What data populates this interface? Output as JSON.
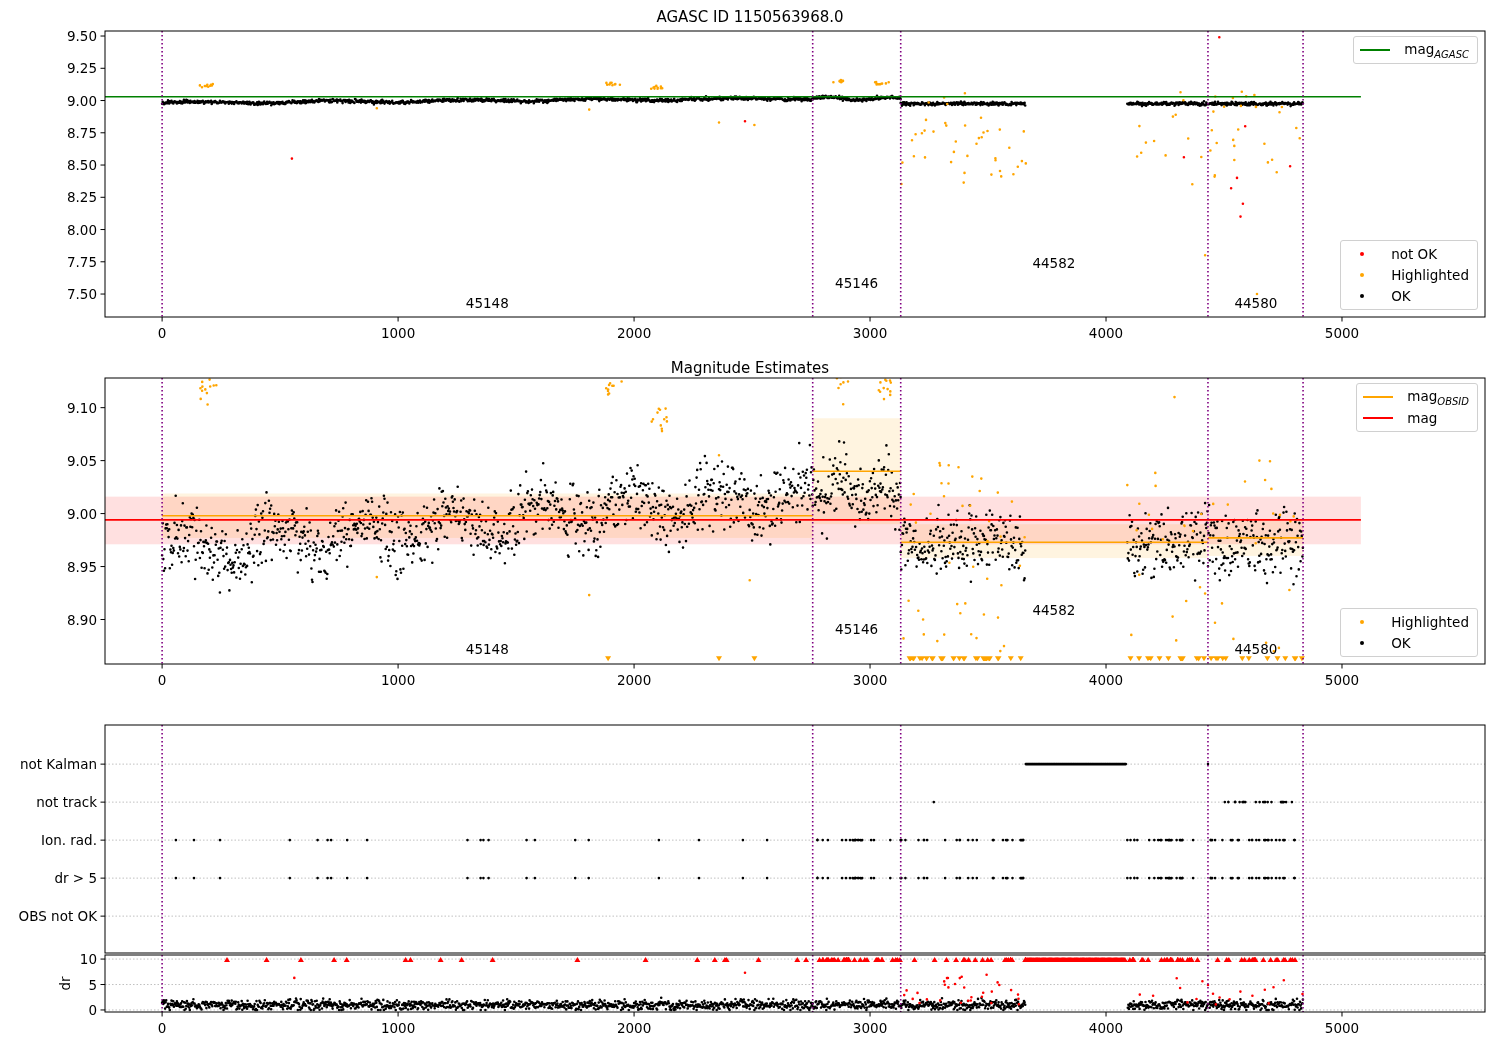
{
  "panels": [
    {
      "kind": "mag",
      "title": "AGASC ID 1150563968.0",
      "legends": [
        {
          "items": [
            {
              "label": "mag$_{AGASC}$",
              "color": "#008000",
              "kind": "line"
            }
          ]
        },
        {
          "items": [
            {
              "label": "not OK",
              "color": "#ff0000",
              "kind": "dot"
            },
            {
              "label": "Highlighted",
              "color": "#ffa500",
              "kind": "dot"
            },
            {
              "label": "OK",
              "color": "#000000",
              "kind": "dot"
            }
          ]
        }
      ],
      "chart_data": {
        "type": "scatter",
        "xlim": [
          -242,
          5606
        ],
        "ylim": [
          7.322,
          9.539
        ],
        "xticks": [
          0,
          1000,
          2000,
          3000,
          4000,
          5000
        ],
        "yticks": [
          {
            "value": 7.5,
            "label": "7.50"
          },
          {
            "value": 7.75,
            "label": "7.75"
          },
          {
            "value": 8.0,
            "label": "8.00"
          },
          {
            "value": 8.25,
            "label": "8.25"
          },
          {
            "value": 8.5,
            "label": "8.50"
          },
          {
            "value": 8.75,
            "label": "8.75"
          },
          {
            "value": 9.0,
            "label": "9.00"
          },
          {
            "value": 9.25,
            "label": "9.25"
          },
          {
            "value": 9.5,
            "label": "9.50"
          }
        ],
        "series": [
          {
            "type": "line",
            "color": "#008000",
            "x": [
              -242,
              5080
            ],
            "values": [
              9.03,
              9.03
            ]
          }
        ],
        "ref_lines": [
          {
            "axis": "x",
            "value": 0
          },
          {
            "axis": "x",
            "value": 2757
          },
          {
            "axis": "x",
            "value": 3130
          },
          {
            "axis": "x",
            "value": 4432
          },
          {
            "axis": "x",
            "value": 4835
          }
        ],
        "annotations": [
          "45148",
          "45146",
          "44582",
          "44580"
        ]
      }
    },
    {
      "kind": "magest",
      "title": "Magnitude Estimates",
      "legends": [
        {
          "items": [
            {
              "label": "mag$_{OBSID}$",
              "color": "#ffa500",
              "kind": "line"
            },
            {
              "label": "mag",
              "color": "#ff0000",
              "kind": "line"
            }
          ]
        },
        {
          "items": [
            {
              "label": "Highlighted",
              "color": "#ffa500",
              "kind": "dot"
            },
            {
              "label": "OK",
              "color": "#000000",
              "kind": "dot"
            }
          ]
        }
      ],
      "chart_data": {
        "type": "scatter",
        "xlim": [
          -242,
          5606
        ],
        "ylim": [
          8.858,
          9.128
        ],
        "xticks": [
          0,
          1000,
          2000,
          3000,
          4000,
          5000
        ],
        "yticks": [
          {
            "value": 8.9,
            "label": "8.90"
          },
          {
            "value": 8.95,
            "label": "8.95"
          },
          {
            "value": 9.0,
            "label": "9.00"
          },
          {
            "value": 9.05,
            "label": "9.05"
          },
          {
            "value": 9.1,
            "label": "9.10"
          }
        ],
        "series": [
          {
            "type": "line",
            "color": "#ffa500",
            "x": [
              0,
              2757
            ],
            "values": [
              8.998,
              8.998
            ]
          },
          {
            "type": "line",
            "color": "#ffa500",
            "x": [
              2757,
              3130
            ],
            "values": [
              9.04,
              9.04
            ]
          },
          {
            "type": "line",
            "color": "#ffa500",
            "x": [
              3130,
              4432
            ],
            "values": [
              8.973,
              8.973
            ]
          },
          {
            "type": "line",
            "color": "#ffa500",
            "x": [
              4432,
              4835
            ],
            "values": [
              8.977,
              8.977
            ]
          },
          {
            "type": "line",
            "color": "#ff0000",
            "x": [
              -242,
              5080
            ],
            "values": [
              8.994,
              8.994
            ]
          }
        ],
        "bands": [
          {
            "axis": "y",
            "from": 8.977,
            "to": 9.019,
            "color": "#ffa500"
          },
          {
            "axis": "y",
            "from": 8.99,
            "to": 9.09,
            "color": "#ffa500"
          },
          {
            "axis": "y",
            "from": 8.958,
            "to": 8.99,
            "color": "#ffa500"
          },
          {
            "axis": "y",
            "from": 8.96,
            "to": 8.994,
            "color": "#ffa500"
          },
          {
            "axis": "y",
            "from": 8.971,
            "to": 9.016,
            "color": "#ff0000"
          }
        ],
        "ref_lines": [
          {
            "axis": "x",
            "value": 0
          },
          {
            "axis": "x",
            "value": 2757
          },
          {
            "axis": "x",
            "value": 3130
          },
          {
            "axis": "x",
            "value": 4432
          },
          {
            "axis": "x",
            "value": 4835
          }
        ],
        "annotations": [
          "45148",
          "45146",
          "44582",
          "44580"
        ]
      }
    },
    {
      "kind": "flags",
      "rows": [
        {
          "label": "not Kalman"
        },
        {
          "label": "not track"
        },
        {
          "label": "Ion. rad."
        },
        {
          "label": "dr > 5"
        },
        {
          "label": "OBS not OK"
        }
      ]
    },
    {
      "kind": "dr",
      "chart_data": {
        "type": "scatter",
        "ylabel": "dr",
        "xlim": [
          -242,
          5606
        ],
        "ylim": [
          -0.4,
          10.8
        ],
        "xticks": [
          0,
          1000,
          2000,
          3000,
          4000,
          5000
        ],
        "yticks": [
          0,
          5,
          10
        ],
        "ref_lines": [
          {
            "axis": "x",
            "value": 0
          },
          {
            "axis": "x",
            "value": 2757
          },
          {
            "axis": "x",
            "value": 3130
          },
          {
            "axis": "x",
            "value": 4432
          },
          {
            "axis": "x",
            "value": 4835
          }
        ]
      }
    }
  ]
}
